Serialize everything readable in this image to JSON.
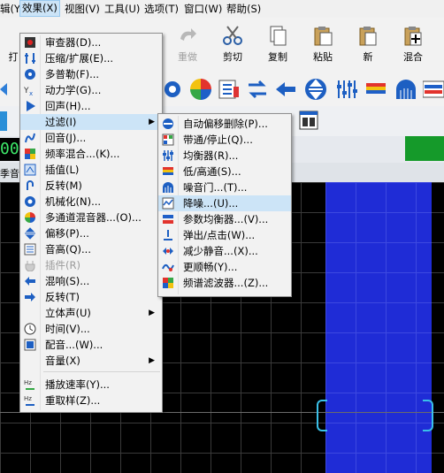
{
  "menubar": {
    "items": [
      {
        "label": "辑(Y)"
      },
      {
        "label": "效果(X)"
      },
      {
        "label": "视图(V)"
      },
      {
        "label": "工具(U)"
      },
      {
        "label": "选项(T)"
      },
      {
        "label": "窗口(W)"
      },
      {
        "label": "帮助(S)"
      }
    ]
  },
  "toolbar": {
    "buttons": [
      {
        "label": "打"
      },
      {
        "label": "重做"
      },
      {
        "label": "剪切"
      },
      {
        "label": "复制"
      },
      {
        "label": "粘贴"
      },
      {
        "label": "新"
      },
      {
        "label": "混合"
      }
    ]
  },
  "left_partial": {
    "label0": "00",
    "label1": "季音"
  },
  "effects_menu": {
    "items": [
      {
        "label": "审查器(D)...",
        "icon": "reviewer-icon"
      },
      {
        "label": "压缩/扩展(E)...",
        "icon": "compress-icon"
      },
      {
        "label": "多普勒(F)...",
        "icon": "doppler-icon"
      },
      {
        "label": "动力学(G)...",
        "icon": "dynamics-icon"
      },
      {
        "label": "回声(H)...",
        "icon": "echo-icon"
      },
      {
        "label": "过滤(I)",
        "icon": "",
        "submenu": true
      },
      {
        "label": "回音(J)...",
        "icon": "reverb-icon"
      },
      {
        "label": "频率混合...(K)...",
        "icon": "freq-mix-icon"
      },
      {
        "label": "插值(L)",
        "icon": "interpolate-icon"
      },
      {
        "label": "反转(M)",
        "icon": "invert-icon"
      },
      {
        "label": "机械化(N)...",
        "icon": "mechanize-icon"
      },
      {
        "label": "多通道混音器...(O)...",
        "icon": "multichannel-icon"
      },
      {
        "label": "偏移(P)...",
        "icon": "offset-icon"
      },
      {
        "label": "音高(Q)...",
        "icon": "pitch-icon"
      },
      {
        "label": "插件(R)",
        "icon": "plugin-icon",
        "disabled": true
      },
      {
        "label": "混响(S)...",
        "icon": "reverb2-icon"
      },
      {
        "label": "反转(T)",
        "icon": "reverse-icon"
      },
      {
        "label": "立体声(U)",
        "icon": "",
        "submenu": true
      },
      {
        "label": "时间(V)...",
        "icon": "time-icon"
      },
      {
        "label": "配音...(W)...",
        "icon": "voiceover-icon"
      },
      {
        "label": "音量(X)",
        "icon": "",
        "submenu": true
      },
      {
        "label": "播放速率(Y)...",
        "icon": "playback-rate-icon"
      },
      {
        "label": "重取样(Z)...",
        "icon": "resample-icon"
      }
    ]
  },
  "filter_submenu": {
    "items": [
      {
        "label": "自动偏移删除(P)...",
        "icon": "auto-offset-icon"
      },
      {
        "label": "带通/停止(Q)...",
        "icon": "bandpass-icon"
      },
      {
        "label": "均衡器(R)...",
        "icon": "equalizer-icon"
      },
      {
        "label": "低/高通(S)...",
        "icon": "lowhigh-icon"
      },
      {
        "label": "噪音门...(T)...",
        "icon": "noise-gate-icon"
      },
      {
        "label": "降噪...(U)...",
        "icon": "denoise-icon"
      },
      {
        "label": "参数均衡器...(V)...",
        "icon": "param-eq-icon"
      },
      {
        "label": "弹出/点击(W)...",
        "icon": "pop-click-icon"
      },
      {
        "label": "减少静音...(X)...",
        "icon": "reduce-silence-icon"
      },
      {
        "label": "更顺畅(Y)...",
        "icon": "smoother-icon"
      },
      {
        "label": "频谱滤波器...(Z)...",
        "icon": "spectral-filter-icon"
      }
    ]
  },
  "colors": {
    "highlight": "#cce4f7",
    "selection": "#1f2cd6",
    "green_indicator": "#159a2a"
  }
}
